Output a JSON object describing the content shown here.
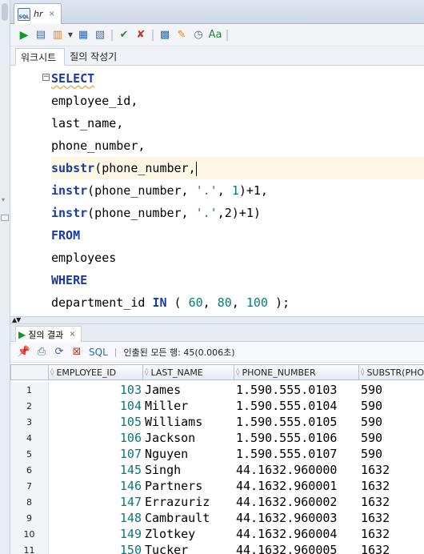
{
  "doc_tab": {
    "name": "hr",
    "close": "×",
    "icon": "SQL"
  },
  "subtabs": [
    "워크시트",
    "질의 작성기"
  ],
  "sql_lines": [
    [
      {
        "t": "SELECT",
        "c": "kw squig"
      }
    ],
    [
      {
        "t": "employee_id,",
        "c": ""
      }
    ],
    [
      {
        "t": "last_name,",
        "c": ""
      }
    ],
    [
      {
        "t": "phone_number,",
        "c": ""
      }
    ],
    [
      {
        "t": "substr",
        "c": "kw"
      },
      {
        "t": "(phone_number,",
        "c": ""
      }
    ],
    [
      {
        "t": "instr",
        "c": "kw"
      },
      {
        "t": "(phone_number, ",
        "c": ""
      },
      {
        "t": "'.'",
        "c": "str"
      },
      {
        "t": ", ",
        "c": ""
      },
      {
        "t": "1",
        "c": "num"
      },
      {
        "t": ")+1,",
        "c": ""
      }
    ],
    [
      {
        "t": "instr",
        "c": "kw"
      },
      {
        "t": "(phone_number, ",
        "c": ""
      },
      {
        "t": "'.'",
        "c": "str"
      },
      {
        "t": ",2)+1)",
        "c": ""
      }
    ],
    [
      {
        "t": "FROM",
        "c": "kw"
      }
    ],
    [
      {
        "t": "employees",
        "c": ""
      }
    ],
    [
      {
        "t": "WHERE",
        "c": "kw"
      }
    ],
    [
      {
        "t": "department_id ",
        "c": ""
      },
      {
        "t": "IN",
        "c": "kw"
      },
      {
        "t": " ( ",
        "c": ""
      },
      {
        "t": "60",
        "c": "num"
      },
      {
        "t": ", ",
        "c": ""
      },
      {
        "t": "80",
        "c": "num"
      },
      {
        "t": ", ",
        "c": ""
      },
      {
        "t": "100",
        "c": "num"
      },
      {
        "t": " );",
        "c": ""
      }
    ]
  ],
  "current_line": 4,
  "results": {
    "tab_label": "질의 결과",
    "close": "×",
    "sql_label": "SQL",
    "fetch_text": "인출된 모든 행: 45(0.006초)",
    "columns": [
      "EMPLOYEE_ID",
      "LAST_NAME",
      "PHONE_NUMBER",
      "SUBSTR(PHO"
    ],
    "rows": [
      [
        "1",
        "103",
        "James",
        "1.590.555.0103",
        "590"
      ],
      [
        "2",
        "104",
        "Miller",
        "1.590.555.0104",
        "590"
      ],
      [
        "3",
        "105",
        "Williams",
        "1.590.555.0105",
        "590"
      ],
      [
        "4",
        "106",
        "Jackson",
        "1.590.555.0106",
        "590"
      ],
      [
        "5",
        "107",
        "Nguyen",
        "1.590.555.0107",
        "590"
      ],
      [
        "6",
        "145",
        "Singh",
        "44.1632.960000",
        "1632"
      ],
      [
        "7",
        "146",
        "Partners",
        "44.1632.960001",
        "1632"
      ],
      [
        "8",
        "147",
        "Errazuriz",
        "44.1632.960002",
        "1632"
      ],
      [
        "9",
        "148",
        "Cambrault",
        "44.1632.960003",
        "1632"
      ],
      [
        "10",
        "149",
        "Zlotkey",
        "44.1632.960004",
        "1632"
      ],
      [
        "11",
        "150",
        "Tucker",
        "44.1632.960005",
        "1632"
      ]
    ]
  },
  "colors": {
    "keyword": "#1a3aa0",
    "string": "#208f20",
    "number": "#0a7a7a",
    "current_line": "#fdf7e6"
  }
}
